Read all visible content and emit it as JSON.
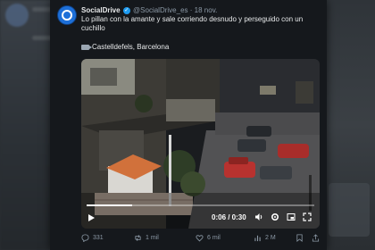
{
  "tweet": {
    "name": "SocialDrive",
    "handle": "@SocialDrive_es",
    "separator": "·",
    "date": "18 nov.",
    "text": "Lo pillan con la amante y sale corriendo desnudo y perseguido con un cuchillo",
    "location": "Castelldefels, Barcelona"
  },
  "video": {
    "time": "0:06 / 0:30",
    "progress_fraction": 0.2
  },
  "actions": {
    "replies": "331",
    "retweets": "1 mil",
    "likes": "6 mil",
    "views": "2 M"
  },
  "icons": [
    "verified-badge-icon",
    "camera-icon",
    "play-icon",
    "volume-icon",
    "settings-icon",
    "pip-icon",
    "fullscreen-icon",
    "reply-icon",
    "retweet-icon",
    "like-icon",
    "views-icon",
    "bookmark-icon",
    "share-icon"
  ],
  "colors": {
    "accent": "#1d9bf0",
    "card_bg": "#15181c",
    "text": "#e7e9ea",
    "muted": "#8b98a5"
  }
}
